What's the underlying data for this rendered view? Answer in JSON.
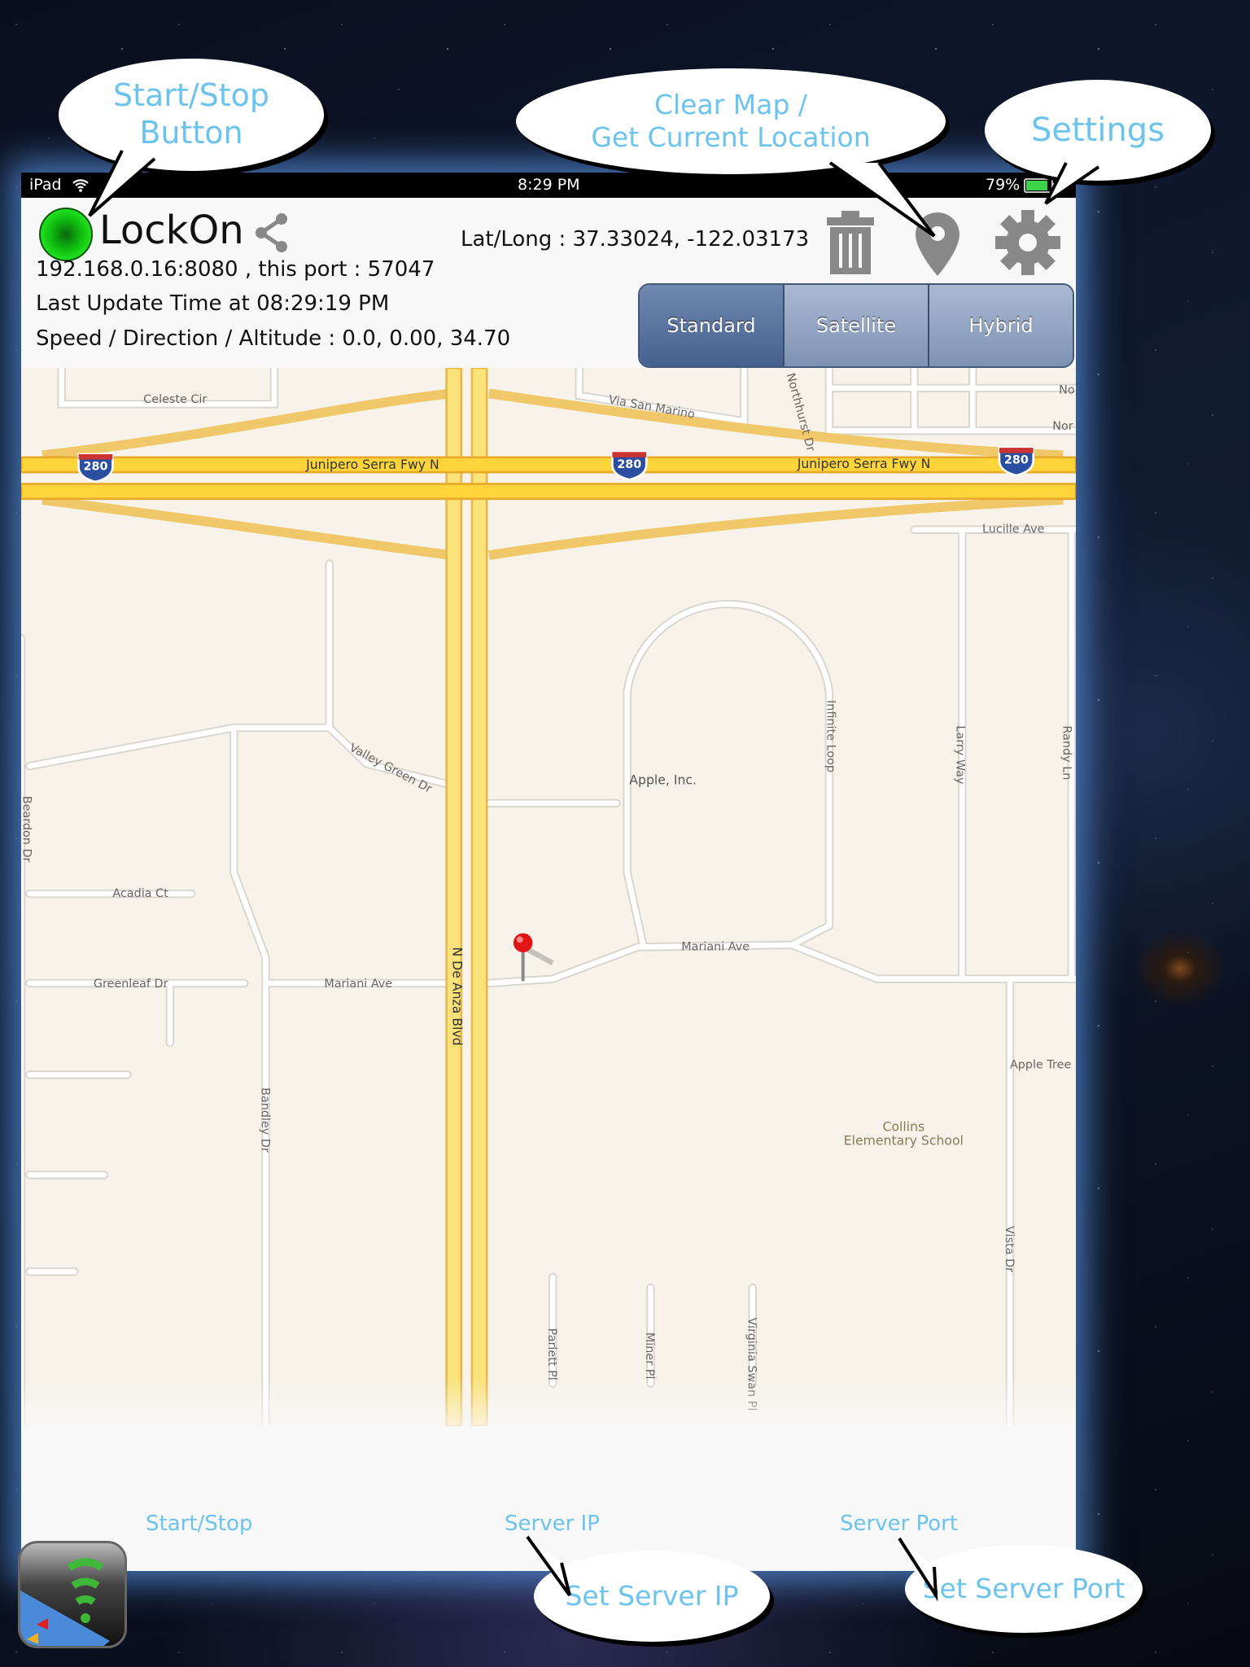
{
  "status_bar": {
    "device": "iPad",
    "time": "8:29 PM",
    "battery": "79%"
  },
  "header": {
    "app_title": "LockOn",
    "server": "192.168.0.16:8080 , this port : 57047",
    "last_update": "Last Update Time at 08:29:19 PM",
    "speed_dir_alt": "Speed / Direction / Altitude : 0.0, 0.00, 34.70",
    "lat_long": "Lat/Long : 37.33024, -122.03173",
    "status_color": "#10c010"
  },
  "map_type": {
    "options": [
      "Standard",
      "Satellite",
      "Hybrid"
    ],
    "selected": "Standard"
  },
  "map_labels": {
    "celeste": "Celeste Cir",
    "via_san_marino": "Via San Marino",
    "northhurst": "Northhurst Dr",
    "no1": "No",
    "no2": "Nor",
    "fwy1": "Junipero Serra Fwy N",
    "fwy2": "Junipero Serra Fwy N",
    "shield": "280",
    "lucille": "Lucille Ave",
    "valley_green": "Valley Green Dr",
    "apple": "Apple, Inc.",
    "infinite": "Infinite Loop",
    "larry": "Larry Way",
    "randy": "Randy Ln",
    "beardon": "Beardon Dr",
    "acadia": "Acadia Ct",
    "greenleaf": "Greenleaf Dr",
    "mariani1": "Mariani Ave",
    "mariani2": "Mariani Ave",
    "de_anza": "N De Anza Blvd",
    "bandley": "Bandley Dr",
    "apple_tree": "Apple Tree",
    "collins1": "Collins",
    "collins2": "Elementary School",
    "vista": "Vista Dr",
    "parlett": "Parlett Pl",
    "miner": "Miner Pl",
    "virginia": "Virginia Swan Pl"
  },
  "tabs": {
    "start_stop": "Start/Stop",
    "server_ip": "Server IP",
    "server_port": "Server Port"
  },
  "callouts": {
    "start_stop_1": "Start/Stop",
    "start_stop_2": "Button",
    "clear_1": "Clear Map /",
    "clear_2": "Get Current Location",
    "settings": "Settings",
    "set_ip": "Set Server IP",
    "set_port": "Set Server Port"
  },
  "icons": [
    "wifi-icon",
    "battery-icon",
    "share-icon",
    "trash-icon",
    "location-pin-icon",
    "gear-icon",
    "map-pin-icon"
  ]
}
